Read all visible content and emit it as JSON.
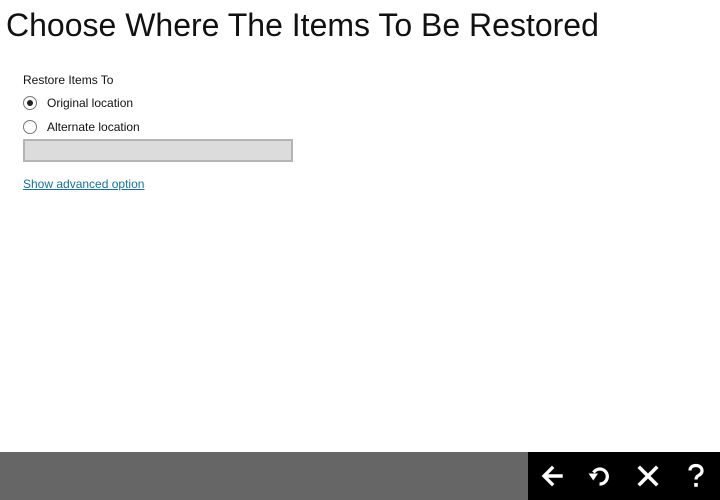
{
  "page": {
    "title": "Choose Where The Items To Be Restored"
  },
  "restore": {
    "section_label": "Restore Items To",
    "options": [
      {
        "label": "Original location",
        "selected": true
      },
      {
        "label": "Alternate location",
        "selected": false
      }
    ],
    "path_value": "",
    "advanced_link": "Show advanced option"
  },
  "footer": {
    "buttons": [
      {
        "icon": "arrow-left-icon"
      },
      {
        "icon": "undo-icon"
      },
      {
        "icon": "close-icon"
      },
      {
        "icon": "help-icon"
      }
    ],
    "background_color": "#666666",
    "nav_background_color": "#000000"
  }
}
